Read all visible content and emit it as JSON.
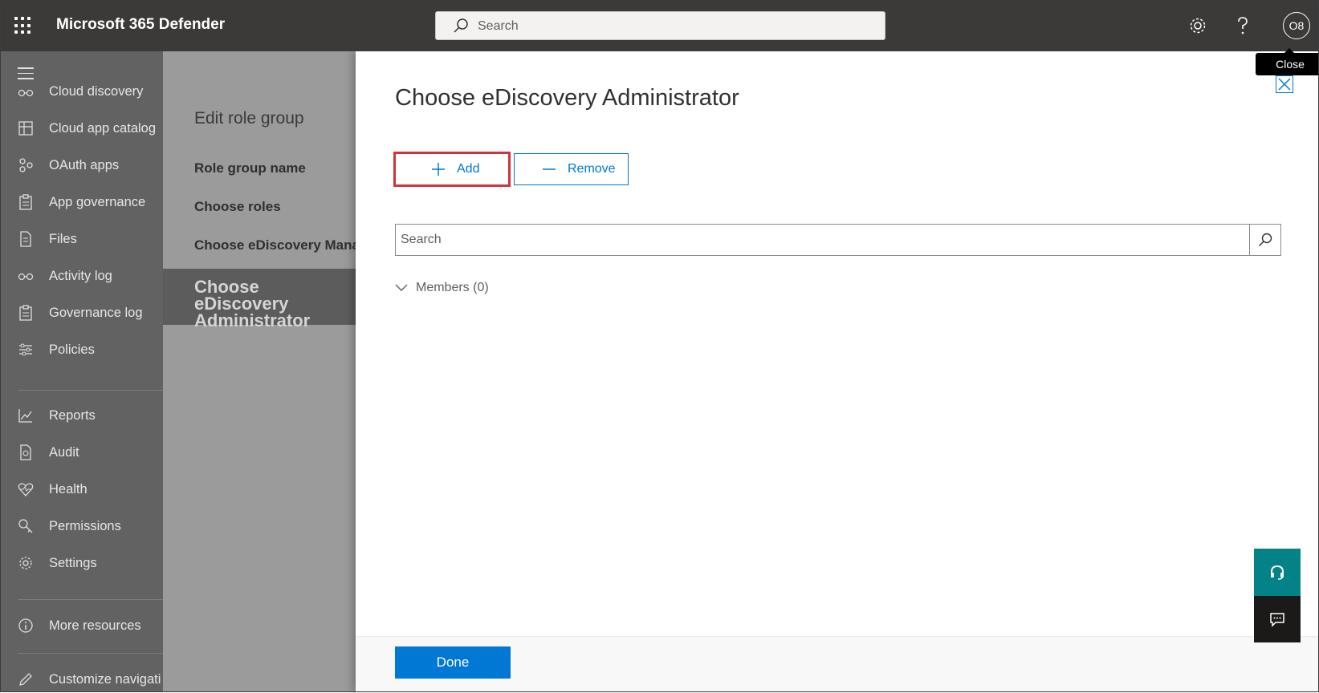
{
  "header": {
    "app_title": "Microsoft 365 Defender",
    "search_placeholder": "Search",
    "avatar_initials": "O8",
    "icons": [
      "app-launcher-icon",
      "search-icon",
      "gear-icon",
      "help-icon"
    ]
  },
  "leftnav": {
    "items": [
      {
        "label": "Cloud discovery",
        "icon": "glasses-icon"
      },
      {
        "label": "Cloud app catalog",
        "icon": "catalog-icon"
      },
      {
        "label": "OAuth apps",
        "icon": "oauth-icon"
      },
      {
        "label": "App governance",
        "icon": "clipboard-icon"
      },
      {
        "label": "Files",
        "icon": "file-icon"
      },
      {
        "label": "Activity log",
        "icon": "glasses-icon"
      },
      {
        "label": "Governance log",
        "icon": "clipboard-icon"
      },
      {
        "label": "Policies",
        "icon": "sliders-icon"
      },
      {
        "label": "Reports",
        "icon": "chart-icon"
      },
      {
        "label": "Audit",
        "icon": "audit-icon"
      },
      {
        "label": "Health",
        "icon": "heart-icon"
      },
      {
        "label": "Permissions",
        "icon": "key-icon"
      },
      {
        "label": "Settings",
        "icon": "gear-icon"
      },
      {
        "label": "More resources",
        "icon": "info-icon"
      },
      {
        "label": "Customize navigati",
        "icon": "pencil-icon"
      }
    ]
  },
  "wizard": {
    "title": "Edit role group",
    "steps": [
      "Role group name",
      "Choose roles",
      "Choose eDiscovery Mana"
    ],
    "active_step": "Choose eDiscovery Administrator"
  },
  "panel": {
    "title": "Choose eDiscovery Administrator",
    "add_label": "Add",
    "remove_label": "Remove",
    "search_placeholder": "Search",
    "members_label": "Members (0)",
    "done_label": "Done",
    "close_tooltip": "Close"
  },
  "colors": {
    "accent": "#0078d4",
    "header_bg": "#3b3a39",
    "highlight_outline": "#d13438",
    "help_button": "#038387"
  }
}
